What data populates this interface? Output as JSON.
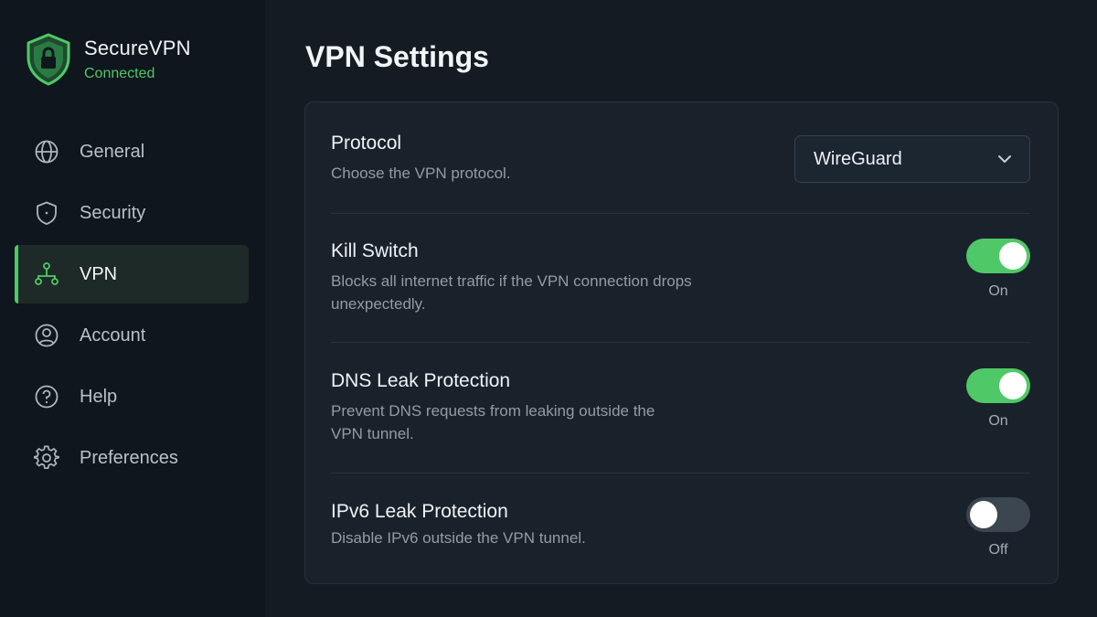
{
  "app": {
    "name": "SecureVPN",
    "status": "Connected",
    "colors": {
      "accent": "#4fc867",
      "sidebar_bg": "#10161d",
      "main_bg": "#141b23",
      "card_bg": "#19222b"
    }
  },
  "sidebar": {
    "items": [
      {
        "label": "General",
        "icon": "globe-icon",
        "active": false
      },
      {
        "label": "Security",
        "icon": "shield-icon",
        "active": false
      },
      {
        "label": "VPN",
        "icon": "network-icon",
        "active": true
      },
      {
        "label": "Account",
        "icon": "user-circle-icon",
        "active": false
      },
      {
        "label": "Help",
        "icon": "help-circle-icon",
        "active": false
      },
      {
        "label": "Preferences",
        "icon": "gear-icon",
        "active": false
      }
    ]
  },
  "main": {
    "title": "VPN Settings",
    "settings": {
      "protocol": {
        "title": "Protocol",
        "description": "Choose the VPN protocol.",
        "selected": "WireGuard"
      },
      "kill_switch": {
        "title": "Kill Switch",
        "description": "Blocks all internet traffic if the VPN connection drops unexpectedly.",
        "state": "On"
      },
      "dns_leak": {
        "title": "DNS Leak Protection",
        "description": "Prevent DNS requests from leaking outside the VPN tunnel.",
        "state": "On"
      },
      "ipv6_leak": {
        "title": "IPv6 Leak Protection",
        "description": "Disable IPv6 outside the VPN tunnel.",
        "state": "Off"
      }
    }
  }
}
